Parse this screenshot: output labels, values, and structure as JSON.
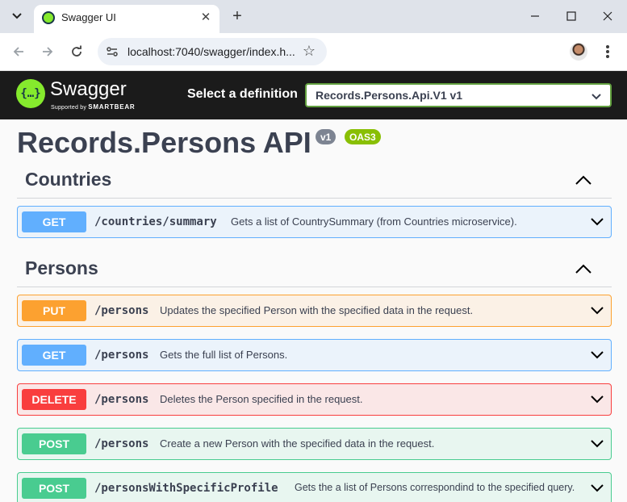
{
  "browser": {
    "tab_title": "Swagger UI",
    "url": "localhost:7040/swagger/index.h..."
  },
  "swagger": {
    "brand": "Swagger",
    "supported_by": "Supported by",
    "smartbear": "SMARTBEAR",
    "definition_label": "Select a definition",
    "definition_selected": "Records.Persons.Api.V1 v1"
  },
  "api": {
    "title": "Records.Persons API",
    "version_badge": "v1",
    "oas_badge": "OAS3"
  },
  "sections": [
    {
      "title": "Countries",
      "operations": [
        {
          "method": "GET",
          "path": "/countries/summary",
          "description": "Gets a list of CountrySummary (from Countries microservice)."
        }
      ]
    },
    {
      "title": "Persons",
      "operations": [
        {
          "method": "PUT",
          "path": "/persons",
          "description": "Updates the specified Person with the specified data in the request."
        },
        {
          "method": "GET",
          "path": "/persons",
          "description": "Gets the full list of Persons."
        },
        {
          "method": "DELETE",
          "path": "/persons",
          "description": "Deletes the Person specified in the request."
        },
        {
          "method": "POST",
          "path": "/persons",
          "description": "Create a new Person with the specified data in the request."
        },
        {
          "method": "POST",
          "path": "/personsWithSpecificProfile",
          "description": "Gets the a list of Persons correspondind to the specified query."
        }
      ]
    }
  ],
  "colors": {
    "get": "#61affe",
    "put": "#fca130",
    "delete": "#f93e3e",
    "post": "#49cc90",
    "swagger_green": "#85ea2d",
    "topbar": "#1b1b1b"
  }
}
